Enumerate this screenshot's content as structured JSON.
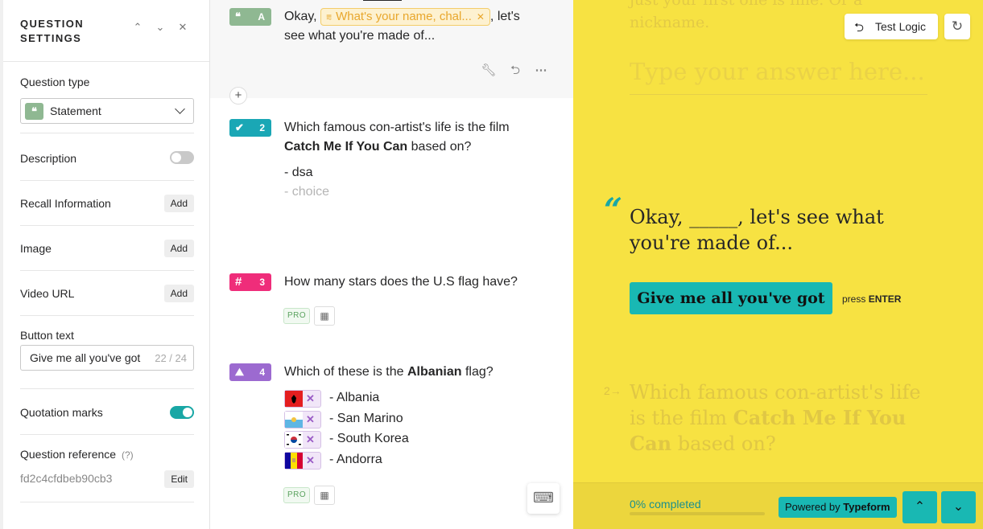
{
  "settings": {
    "title_line1": "QUESTION",
    "title_line2": "SETTINGS",
    "question_type_label": "Question type",
    "question_type_value": "Statement",
    "description_label": "Description",
    "recall_label": "Recall Information",
    "recall_button": "Add",
    "image_label": "Image",
    "image_button": "Add",
    "video_label": "Video URL",
    "video_button": "Add",
    "button_text_label": "Button text",
    "button_text_value": "Give me all you've got",
    "button_text_count": "22 / 24",
    "quotation_label": "Quotation marks",
    "reference_label": "Question reference",
    "reference_help": "(?)",
    "reference_value": "fd2c4cfdbeb90cb3",
    "reference_button": "Edit",
    "description_on": false,
    "quotation_on": true
  },
  "questions": {
    "q1": {
      "badge": "A",
      "text_start": "Okay,",
      "recall_chip": "What's your name, chal...",
      "text_mid": ", let's",
      "text_line2": "see what you're made of..."
    },
    "q2": {
      "badge": "2",
      "line1": "Which famous con-artist's life is the film",
      "bold": "Catch Me If You Can",
      "line2_rest": " based on?",
      "choice1": "- dsa",
      "choice_placeholder": "- choice"
    },
    "q3": {
      "badge": "3",
      "text": "How many stars does the U.S flag have?",
      "pro": "PRO"
    },
    "q4": {
      "badge": "4",
      "text_start": "Which of these is the ",
      "bold": "Albanian",
      "text_end": " flag?",
      "options": [
        "- Albania",
        "- San Marino",
        "- South Korea",
        "- Andorra"
      ],
      "pro": "PRO"
    }
  },
  "preview": {
    "ghost_top": "just your first one is fine. Or a nickname.",
    "ghost_placeholder": "Type your answer here...",
    "test_logic": "Test Logic",
    "statement": "Okay, _____, let's see what you're made of...",
    "cta": "Give me all you've got",
    "press": "press",
    "press_key": "ENTER",
    "next_num": "2→",
    "next_q_start": "Which famous con-artist's life is the film ",
    "next_q_bold": "Catch Me If You Can",
    "next_q_end": " based on?",
    "progress_text": "0% completed",
    "progress_value": 0,
    "powered_by": "Powered by",
    "powered_brand": "Typeform"
  },
  "colors": {
    "preview_bg": "#f7e242",
    "accent": "#19b8b3",
    "statement_badge": "#8fb892",
    "choice_badge": "#1aa7b5",
    "number_badge": "#ef2d7a",
    "picture_badge": "#9c6ad0"
  }
}
